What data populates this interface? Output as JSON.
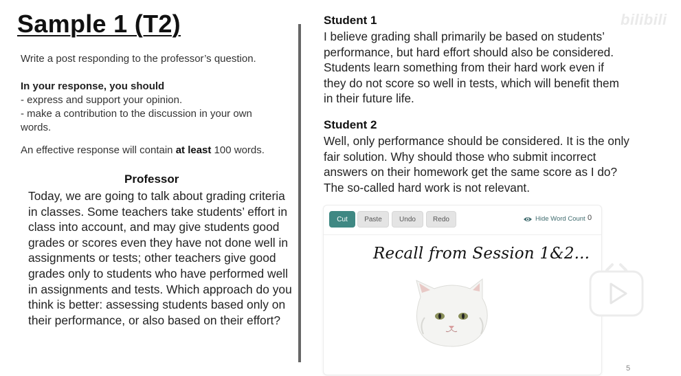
{
  "left": {
    "title": "Sample 1 (T2)",
    "instruction": "Write a post responding to the professor’s question.",
    "response_heading": "In your response, you should",
    "bullets": [
      "- express and support your opinion.",
      "- make a contribution to the discussion in your own words."
    ],
    "effective": {
      "before": "An effective response will contain ",
      "bold": "at least",
      "after": " 100 words."
    },
    "professor": {
      "heading": "Professor",
      "text": "Today, we are going to talk about grading criteria in classes. Some teachers take students’ effort in class into account, and may give students good grades or scores even they have not done well in assignments or tests; other teachers give good grades only to students who have performed well in assignments and tests. Which approach do you think is better: assessing students based only on their performance, or also based on their effort?"
    }
  },
  "right": {
    "student1": {
      "heading": "Student 1",
      "text": "I believe grading shall primarily be based on students’ performance, but hard effort should also be considered. Students learn something from their hard work even if they do not score so well in tests, which will benefit them in their future life."
    },
    "student2": {
      "heading": "Student 2",
      "text": "Well, only performance should be considered. It is the only fair solution. Why should those who submit incorrect answers on their homework get the same score as I do? The so-called hard work is not relevant."
    }
  },
  "editor": {
    "toolbar": {
      "cut": "Cut",
      "paste": "Paste",
      "undo": "Undo",
      "redo": "Redo",
      "hide_word_count": "Hide Word Count",
      "word_count": "0"
    },
    "content_text": "Recall from Session 1&2..."
  },
  "watermark": "bilibili",
  "page_number": "5",
  "colors": {
    "accent": "#3f8883",
    "divider": "#666666",
    "button": "#e4e4e4"
  },
  "icons": [
    "eye-icon",
    "play-icon",
    "cat-image"
  ]
}
